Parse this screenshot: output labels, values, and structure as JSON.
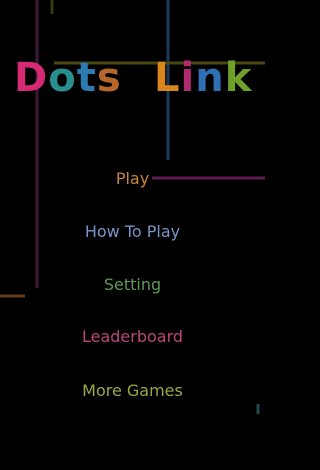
{
  "title": {
    "word1": {
      "letters": [
        {
          "ch": "D",
          "color": "#d62a74"
        },
        {
          "ch": "o",
          "color": "#2b8e8e"
        },
        {
          "ch": "t",
          "color": "#2c7bb3"
        },
        {
          "ch": "s",
          "color": "#b8662c"
        }
      ]
    },
    "word2": {
      "letters": [
        {
          "ch": "L",
          "color": "#d9861d"
        },
        {
          "ch": "i",
          "color": "#b02c6e"
        },
        {
          "ch": "n",
          "color": "#2f6fb4"
        },
        {
          "ch": "k",
          "color": "#6ea02a"
        }
      ]
    }
  },
  "menu": {
    "play": "Play",
    "how_to_play": "How To Play",
    "setting": "Setting",
    "leaderboard": "Leaderboard",
    "more_games": "More Games"
  },
  "colors": {
    "background": "#000000",
    "line_purple": "#5a1d4a",
    "line_yellow": "#4c4a12",
    "line_blue": "#1f3f63",
    "line_orange": "#6a3a18",
    "line_magenta": "#6b1f5e",
    "line_teal": "#1d4a4a"
  }
}
